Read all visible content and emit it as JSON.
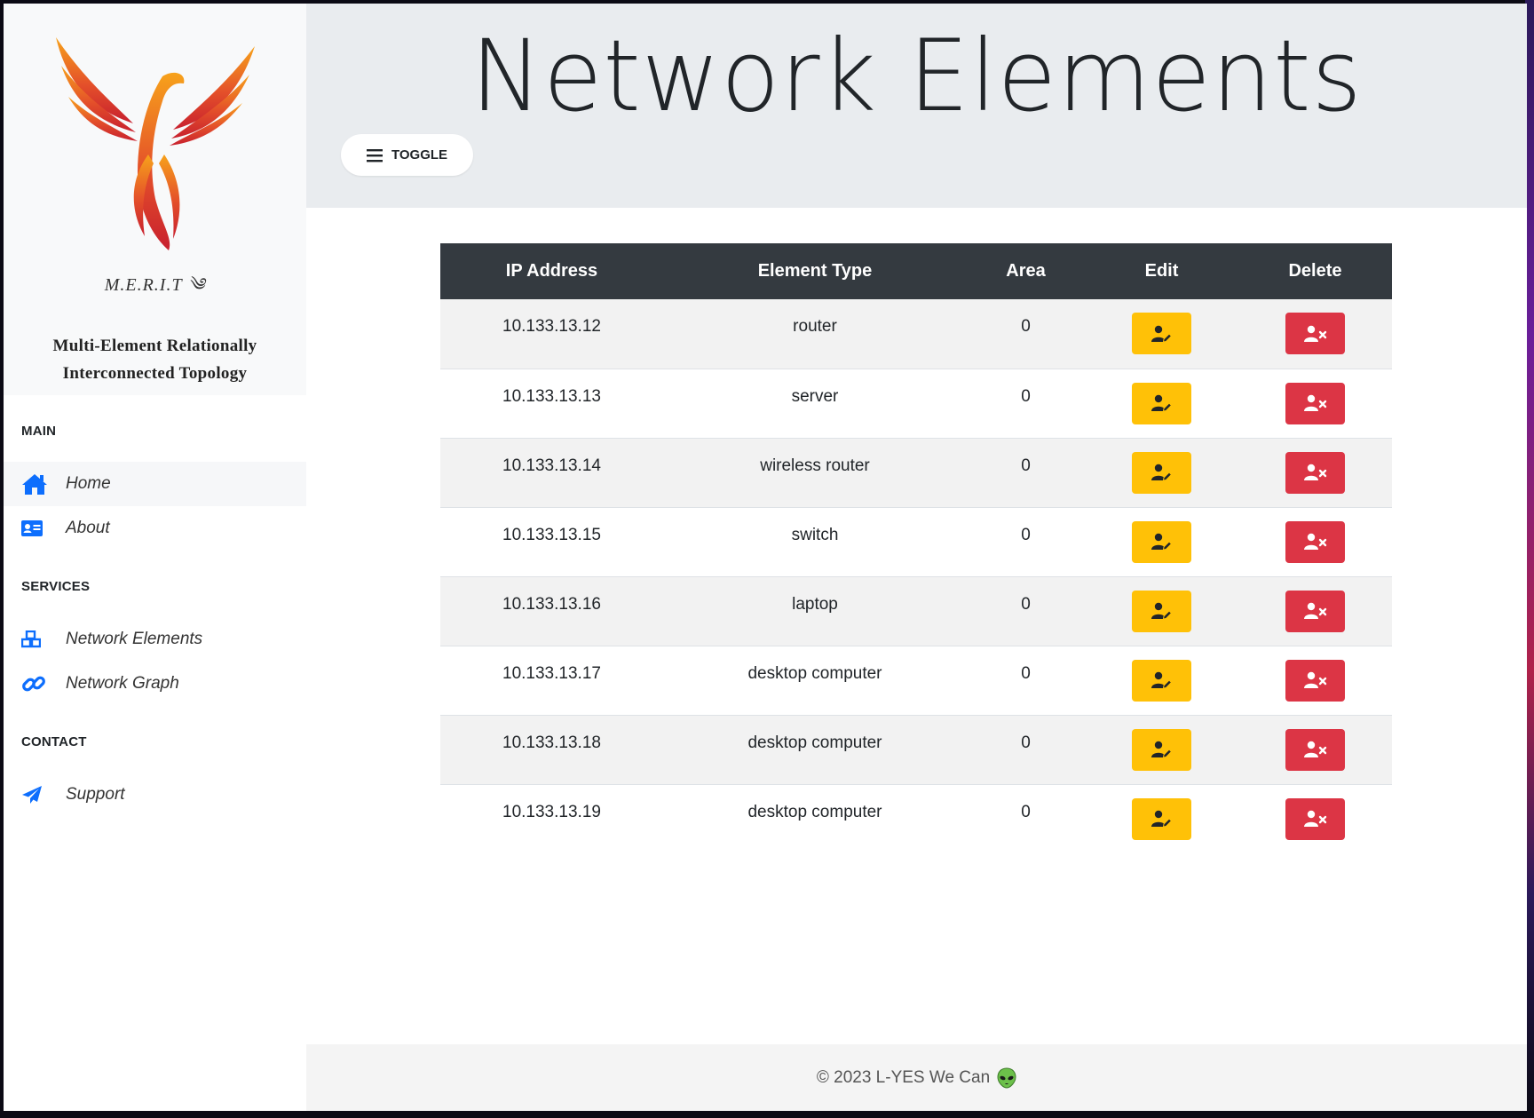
{
  "brand": {
    "short_name": "M.E.R.I.T ༄",
    "long_name_line1": "Multi-Element Relationally",
    "long_name_line2": "Interconnected Topology"
  },
  "sidebar": {
    "sections": [
      {
        "title": "MAIN",
        "items": [
          {
            "label": "Home",
            "icon": "home-icon"
          },
          {
            "label": "About",
            "icon": "id-card-icon"
          }
        ]
      },
      {
        "title": "SERVICES",
        "items": [
          {
            "label": "Network Elements",
            "icon": "cubes-icon"
          },
          {
            "label": "Network Graph",
            "icon": "link-icon"
          }
        ]
      },
      {
        "title": "CONTACT",
        "items": [
          {
            "label": "Support",
            "icon": "paper-plane-icon"
          }
        ]
      }
    ]
  },
  "header": {
    "title": "Network Elements",
    "toggle_label": "TOGGLE"
  },
  "table": {
    "columns": [
      "IP Address",
      "Element Type",
      "Area",
      "Edit",
      "Delete"
    ],
    "rows": [
      {
        "ip": "10.133.13.12",
        "type": "router",
        "area": "0"
      },
      {
        "ip": "10.133.13.13",
        "type": "server",
        "area": "0"
      },
      {
        "ip": "10.133.13.14",
        "type": "wireless router",
        "area": "0"
      },
      {
        "ip": "10.133.13.15",
        "type": "switch",
        "area": "0"
      },
      {
        "ip": "10.133.13.16",
        "type": "laptop",
        "area": "0"
      },
      {
        "ip": "10.133.13.17",
        "type": "desktop computer",
        "area": "0"
      },
      {
        "ip": "10.133.13.18",
        "type": "desktop computer",
        "area": "0"
      },
      {
        "ip": "10.133.13.19",
        "type": "desktop computer",
        "area": "0"
      }
    ]
  },
  "footer": {
    "text": "© 2023 L-YES We Can",
    "icon": "alien-icon"
  },
  "colors": {
    "accent": "#0d6efd",
    "edit": "#ffc107",
    "delete": "#dc3545",
    "table_header": "#343a40"
  }
}
